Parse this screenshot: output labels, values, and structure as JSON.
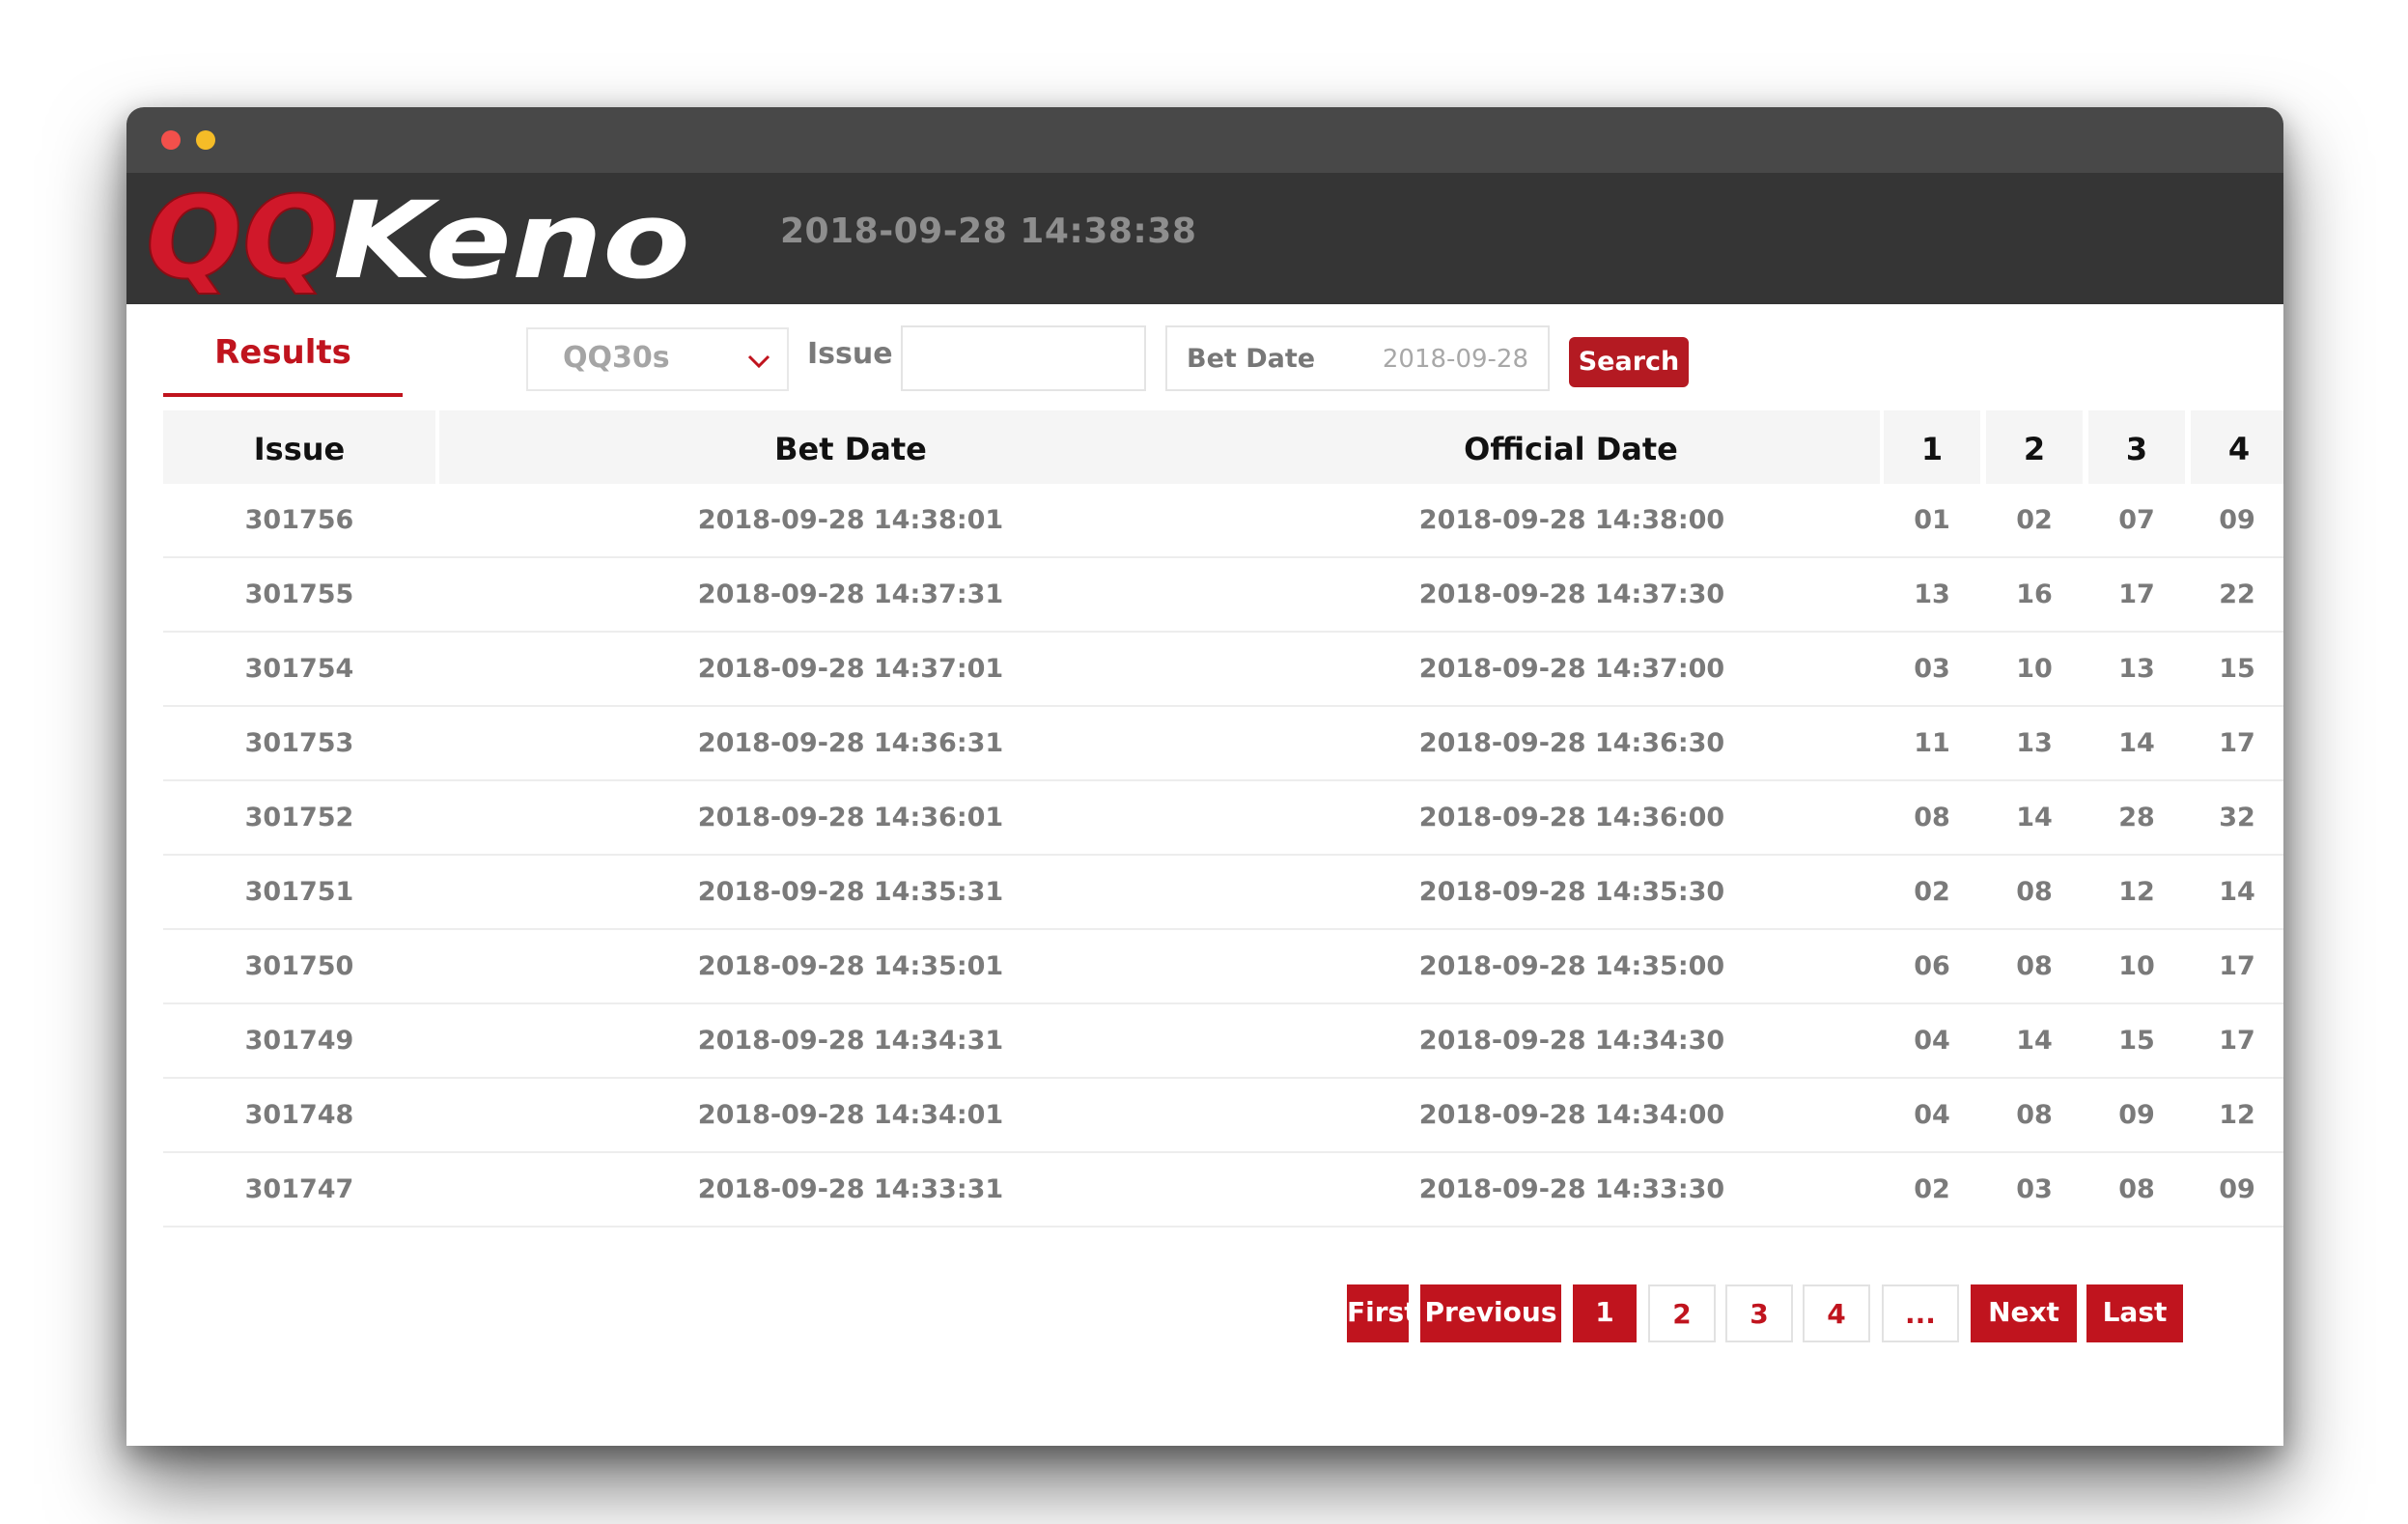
{
  "window": {
    "controls": [
      "close",
      "minimize"
    ]
  },
  "header": {
    "logo_text_primary": "QQ",
    "logo_text_secondary": "Keno",
    "clock": "2018-09-28 14:38:38",
    "colors": {
      "brand_red": "#c0141e",
      "header_bg": "#353535"
    }
  },
  "toolbar": {
    "tab_results": "Results",
    "game_select": {
      "value": "QQ30s"
    },
    "issue_label": "Issue",
    "issue_value": "",
    "bet_date_label": "Bet Date",
    "bet_date_value": "2018-09-28",
    "search_label": "Search"
  },
  "table": {
    "headers": [
      "Issue",
      "Bet Date",
      "Official Date",
      "1",
      "2",
      "3",
      "4"
    ],
    "rows": [
      [
        "301756",
        "2018-09-28 14:38:01",
        "2018-09-28 14:38:00",
        "01",
        "02",
        "07",
        "09"
      ],
      [
        "301755",
        "2018-09-28 14:37:31",
        "2018-09-28 14:37:30",
        "13",
        "16",
        "17",
        "22"
      ],
      [
        "301754",
        "2018-09-28 14:37:01",
        "2018-09-28 14:37:00",
        "03",
        "10",
        "13",
        "15"
      ],
      [
        "301753",
        "2018-09-28 14:36:31",
        "2018-09-28 14:36:30",
        "11",
        "13",
        "14",
        "17"
      ],
      [
        "301752",
        "2018-09-28 14:36:01",
        "2018-09-28 14:36:00",
        "08",
        "14",
        "28",
        "32"
      ],
      [
        "301751",
        "2018-09-28 14:35:31",
        "2018-09-28 14:35:30",
        "02",
        "08",
        "12",
        "14"
      ],
      [
        "301750",
        "2018-09-28 14:35:01",
        "2018-09-28 14:35:00",
        "06",
        "08",
        "10",
        "17"
      ],
      [
        "301749",
        "2018-09-28 14:34:31",
        "2018-09-28 14:34:30",
        "04",
        "14",
        "15",
        "17"
      ],
      [
        "301748",
        "2018-09-28 14:34:01",
        "2018-09-28 14:34:00",
        "04",
        "08",
        "09",
        "12"
      ],
      [
        "301747",
        "2018-09-28 14:33:31",
        "2018-09-28 14:33:30",
        "02",
        "03",
        "08",
        "09"
      ]
    ]
  },
  "pagination": {
    "first": "First",
    "previous": "Previous",
    "pages": [
      "1",
      "2",
      "3",
      "4",
      "..."
    ],
    "current": "1",
    "next": "Next",
    "last": "Last"
  }
}
